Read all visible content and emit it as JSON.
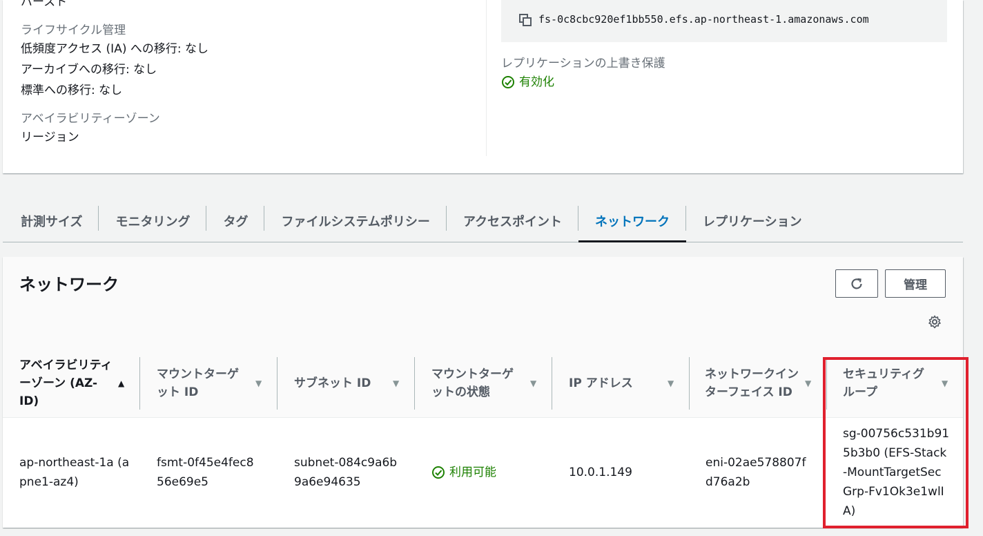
{
  "details": {
    "truncated_top": "バースト",
    "lifecycle_label": "ライフサイクル管理",
    "lifecycle_values": [
      "低頻度アクセス (IA) への移行: なし",
      "アーカイブへの移行: なし",
      "標準への移行: なし"
    ],
    "az_label": "アベイラビリティーゾーン",
    "az_value": "リージョン",
    "dns_name": "fs-0c8cbc920ef1bb550.efs.ap-northeast-1.amazonaws.com",
    "replication_protection_label": "レプリケーションの上書き保護",
    "replication_protection_value": "有効化"
  },
  "tabs": [
    "計測サイズ",
    "モニタリング",
    "タグ",
    "ファイルシステムポリシー",
    "アクセスポイント",
    "ネットワーク",
    "レプリケーション"
  ],
  "active_tab": "ネットワーク",
  "network": {
    "title": "ネットワーク",
    "manage_label": "管理",
    "columns": [
      "アベイラビリティーゾーン (AZ-ID)",
      "マウントターゲット ID",
      "サブネット ID",
      "マウントターゲットの状態",
      "IP アドレス",
      "ネットワークインターフェイス ID",
      "セキュリティグループ"
    ],
    "rows": [
      {
        "az": "ap-northeast-1a (apne1-az4)",
        "mount_target_id": "fsmt-0f45e4fec856e69e5",
        "subnet_id": "subnet-084c9a6b9a6e94635",
        "state": "利用可能",
        "ip": "10.0.1.149",
        "eni_id": "eni-02ae578807fd76a2b",
        "security_group": "sg-00756c531b915b3b0 (EFS-Stack-MountTargetSecGrp-Fv1Ok3e1wlIA)"
      }
    ]
  },
  "colors": {
    "accent": "#0073bb",
    "success": "#1d8102",
    "highlight": "#e0202e"
  }
}
